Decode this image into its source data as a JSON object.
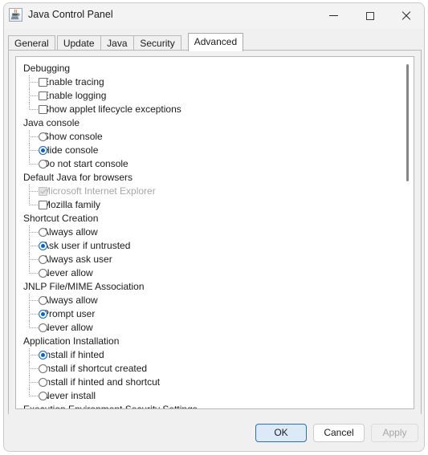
{
  "window": {
    "title": "Java Control Panel",
    "icon": "java-cup-icon",
    "controls": {
      "minimize": "minimize-icon",
      "maximize": "maximize-icon",
      "close": "close-icon"
    }
  },
  "tabs": [
    {
      "label": "General",
      "active": false
    },
    {
      "label": "Update",
      "active": false
    },
    {
      "label": "Java",
      "active": false
    },
    {
      "label": "Security",
      "active": false
    },
    {
      "label": "Advanced",
      "active": true
    }
  ],
  "settings_tree": [
    {
      "group": "Debugging",
      "items": [
        {
          "label": "Enable tracing",
          "control": "checkbox",
          "checked": false,
          "disabled": false
        },
        {
          "label": "Enable logging",
          "control": "checkbox",
          "checked": false,
          "disabled": false
        },
        {
          "label": "Show applet lifecycle exceptions",
          "control": "checkbox",
          "checked": false,
          "disabled": false
        }
      ]
    },
    {
      "group": "Java console",
      "items": [
        {
          "label": "Show console",
          "control": "radio",
          "checked": false,
          "disabled": false
        },
        {
          "label": "Hide console",
          "control": "radio",
          "checked": true,
          "disabled": false
        },
        {
          "label": "Do not start console",
          "control": "radio",
          "checked": false,
          "disabled": false
        }
      ]
    },
    {
      "group": "Default Java for browsers",
      "items": [
        {
          "label": "Microsoft Internet Explorer",
          "control": "checkbox",
          "checked": true,
          "disabled": true
        },
        {
          "label": "Mozilla family",
          "control": "checkbox",
          "checked": false,
          "disabled": false
        }
      ]
    },
    {
      "group": "Shortcut Creation",
      "items": [
        {
          "label": "Always allow",
          "control": "radio",
          "checked": false,
          "disabled": false
        },
        {
          "label": "Ask user if untrusted",
          "control": "radio",
          "checked": true,
          "disabled": false
        },
        {
          "label": "Always ask user",
          "control": "radio",
          "checked": false,
          "disabled": false
        },
        {
          "label": "Never allow",
          "control": "radio",
          "checked": false,
          "disabled": false
        }
      ]
    },
    {
      "group": "JNLP File/MIME Association",
      "items": [
        {
          "label": "Always allow",
          "control": "radio",
          "checked": false,
          "disabled": false
        },
        {
          "label": "Prompt user",
          "control": "radio",
          "checked": true,
          "disabled": false
        },
        {
          "label": "Never allow",
          "control": "radio",
          "checked": false,
          "disabled": false
        }
      ]
    },
    {
      "group": "Application Installation",
      "items": [
        {
          "label": "Install if hinted",
          "control": "radio",
          "checked": true,
          "disabled": false
        },
        {
          "label": "Install if shortcut created",
          "control": "radio",
          "checked": false,
          "disabled": false
        },
        {
          "label": "Install if hinted and shortcut",
          "control": "radio",
          "checked": false,
          "disabled": false
        },
        {
          "label": "Never install",
          "control": "radio",
          "checked": false,
          "disabled": false
        }
      ]
    },
    {
      "group": "Execution Environment Security Settings",
      "items": [
        {
          "label": "",
          "control": "checkbox",
          "checked": true,
          "disabled": false,
          "clipped": true
        }
      ]
    }
  ],
  "scrollbar": {
    "name": "vertical-scrollbar",
    "thumb_top_pct": 2,
    "thumb_height_pct": 33
  },
  "footer": {
    "ok_label": "OK",
    "cancel_label": "Cancel",
    "apply_label": "Apply",
    "apply_disabled": true
  },
  "colors": {
    "accent": "#0b63c5",
    "default_button_border": "#2f6fb5",
    "default_button_fill": "#dceaf7",
    "disabled_text": "#a6a6a6",
    "window_bg": "#f0f0f0",
    "titlebar_bg": "#f3f3f3"
  }
}
